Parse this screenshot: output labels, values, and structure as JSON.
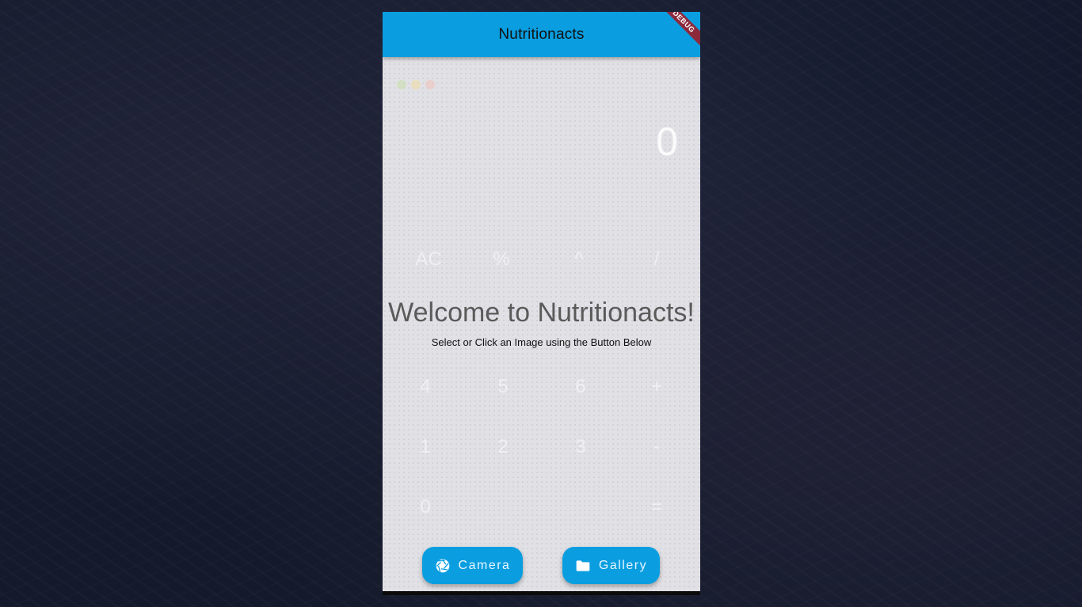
{
  "app": {
    "title": "Nutritionacts",
    "debug_banner": "DEBUG"
  },
  "ghost_calculator": {
    "display": "0",
    "keys_row1": [
      "AC",
      "%",
      "^",
      "/"
    ],
    "keys_row2": [
      "4",
      "5",
      "6",
      "+"
    ],
    "keys_row3": [
      "1",
      "2",
      "3",
      "-"
    ],
    "keys_row4": [
      "0",
      "="
    ]
  },
  "main": {
    "welcome": "Welcome to Nutritionacts!",
    "subtitle": "Select or Click an Image using the Button Below"
  },
  "buttons": {
    "camera_label": "Camera",
    "camera_icon": "camera-aperture-icon",
    "gallery_label": "Gallery",
    "gallery_icon": "folder-icon"
  },
  "colors": {
    "accent": "#0a9ee0",
    "content_bg": "#e1e1e5",
    "debug_banner": "#8c2a3c",
    "desktop_bg": "#141a2c"
  }
}
